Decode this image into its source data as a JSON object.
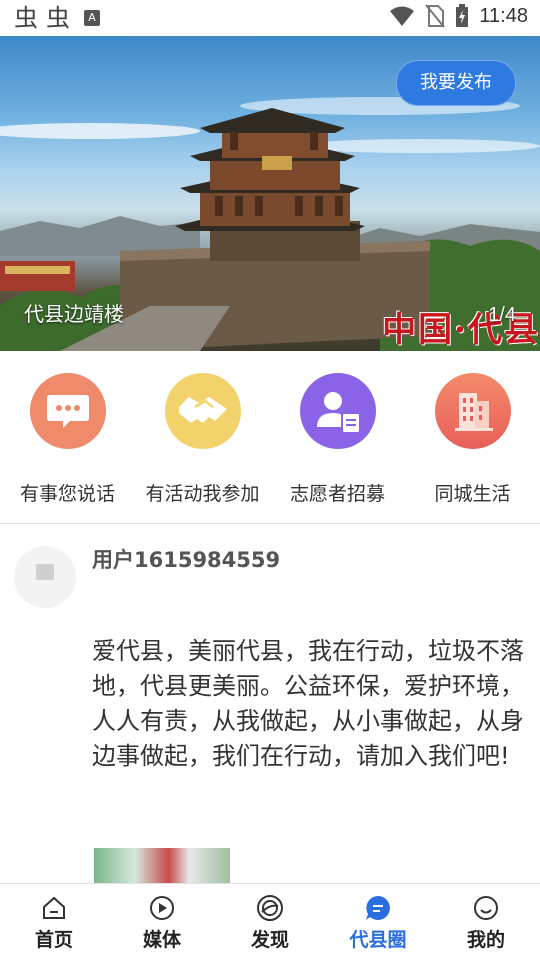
{
  "status_bar": {
    "time": "11:48",
    "left_glyph": "虫",
    "notification_letter": "A"
  },
  "banner": {
    "publish_label": "我要发布",
    "caption": "代县边靖楼",
    "page_indicator": "1/4",
    "watermark": "中国·代县"
  },
  "quick_actions": [
    {
      "label": "有事您说话",
      "icon": "speech-bubble-icon",
      "color": "#ef8a6a"
    },
    {
      "label": "有活动我参加",
      "icon": "handshake-icon",
      "color": "#f2d36b"
    },
    {
      "label": "志愿者招募",
      "icon": "volunteer-badge-icon",
      "color": "#8a63e6"
    },
    {
      "label": "同城生活",
      "icon": "building-icon",
      "color": "#f0775f"
    }
  ],
  "post": {
    "username": "用户1615984559",
    "content": "爱代县，美丽代县，我在行动，垃圾不落地，代县更美丽。公益环保，爱护环境，人人有责，从我做起，从小事做起，从身边事做起，我们在行动，请加入我们吧!"
  },
  "bottom_nav": [
    {
      "label": "首页",
      "icon": "home-icon",
      "active": false
    },
    {
      "label": "媒体",
      "icon": "play-icon",
      "active": false
    },
    {
      "label": "发现",
      "icon": "discover-icon",
      "active": false
    },
    {
      "label": "代县圈",
      "icon": "chat-bubble-icon",
      "active": true
    },
    {
      "label": "我的",
      "icon": "smiley-icon",
      "active": false
    }
  ],
  "colors": {
    "accent": "#2a6ee0",
    "publish_button": "#2f7ae0"
  }
}
